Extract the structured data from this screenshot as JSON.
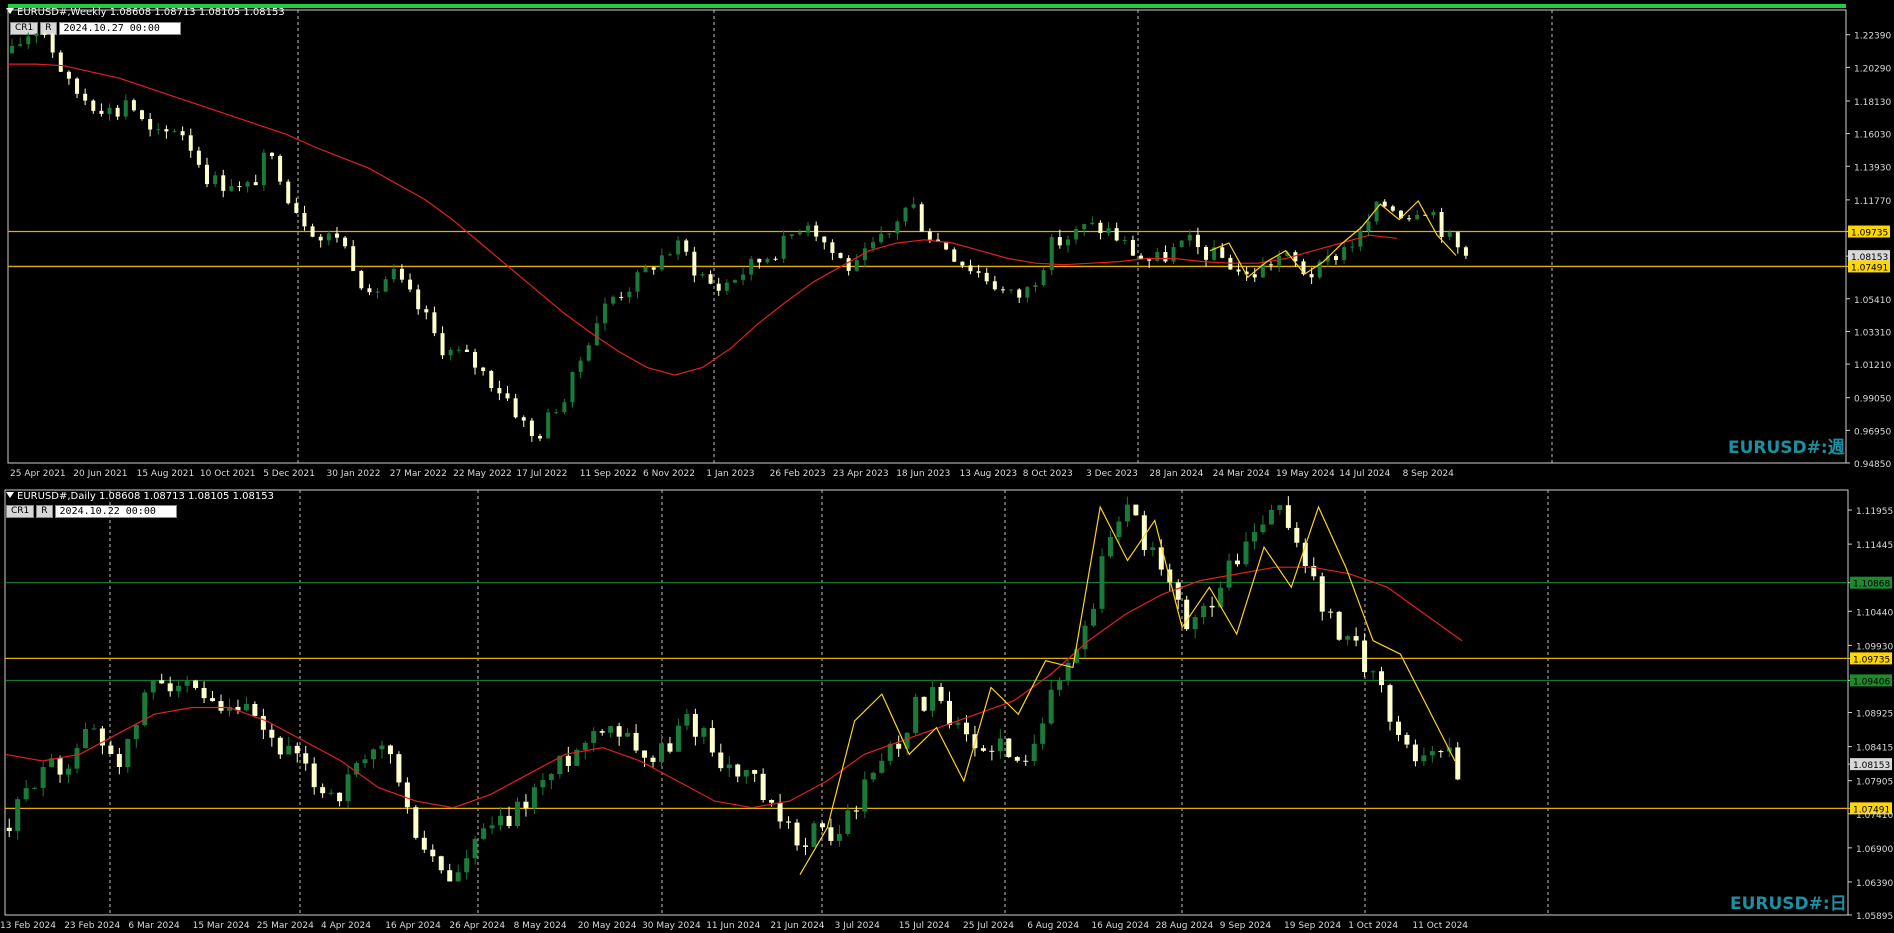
{
  "colors": {
    "bull": "#1a7a3a",
    "bear": "#ffffcc",
    "ma": "#e02020",
    "zigzag": "#ffd21e",
    "hline": "#e0b000",
    "green_line": "#1d8a2f",
    "grid": "#bfbfbf",
    "axis_text": "#d8d8d8",
    "watermark": "#1e8fa0"
  },
  "toolbar": {
    "cr1": "CR1",
    "r": "R"
  },
  "weekly": {
    "header": "EURUSD#,Weekly  1.08608 1.08713 1.08105 1.08153",
    "date_box": "2024.10.27  00:00",
    "watermark": "EURUSD#:週",
    "chart_data": {
      "type": "candlestick",
      "ylim": [
        0.9485,
        1.2398
      ],
      "yticks": [
        "1.22390",
        "1.20290",
        "1.18130",
        "1.16030",
        "1.13930",
        "1.11770",
        "1.09735",
        "1.08153",
        "1.07491",
        "1.05410",
        "1.03310",
        "1.01210",
        "0.99050",
        "0.96950",
        "0.94850"
      ],
      "xlabels": [
        "25 Apr 2021",
        "20 Jun 2021",
        "15 Aug 2021",
        "10 Oct 2021",
        "5 Dec 2021",
        "30 Jan 2022",
        "27 Mar 2022",
        "22 May 2022",
        "17 Jul 2022",
        "11 Sep 2022",
        "6 Nov 2022",
        "1 Jan 2023",
        "26 Feb 2023",
        "23 Apr 2023",
        "18 Jun 2023",
        "13 Aug 2023",
        "8 Oct 2023",
        "3 Dec 2023",
        "28 Jan 2024",
        "24 Mar 2024",
        "19 May 2024",
        "14 Jul 2024",
        "8 Sep 2024"
      ],
      "hlines": [
        {
          "value": 1.09735,
          "label": "1.09735"
        },
        {
          "value": 1.07491,
          "label": "1.07491"
        }
      ],
      "current_price": "1.08153",
      "close_path": [
        1.212,
        1.222,
        1.228,
        1.225,
        1.206,
        1.19,
        1.185,
        1.18,
        1.178,
        1.172,
        1.185,
        1.17,
        1.16,
        1.158,
        1.165,
        1.16,
        1.145,
        1.132,
        1.128,
        1.13,
        1.122,
        1.13,
        1.145,
        1.14,
        1.12,
        1.108,
        1.1,
        1.09,
        1.098,
        1.085,
        1.072,
        1.052,
        1.065,
        1.07,
        1.06,
        1.05,
        1.04,
        1.025,
        1.02,
        1.018,
        1.013,
        1.005,
        0.998,
        0.99,
        0.978,
        0.965,
        0.97,
        0.985,
        0.99,
        1.01,
        1.03,
        1.045,
        1.055,
        1.06,
        1.065,
        1.072,
        1.08,
        1.085,
        1.088,
        1.075,
        1.068,
        1.06,
        1.065,
        1.07,
        1.075,
        1.08,
        1.085,
        1.09,
        1.1,
        1.105,
        1.095,
        1.085,
        1.078,
        1.072,
        1.082,
        1.09,
        1.095,
        1.11,
        1.115,
        1.1,
        1.092,
        1.088,
        1.08,
        1.075,
        1.07,
        1.065,
        1.058,
        1.055,
        1.06,
        1.072,
        1.088,
        1.092,
        1.095,
        1.1,
        1.1,
        1.098,
        1.092,
        1.085,
        1.08,
        1.078,
        1.082,
        1.087,
        1.09,
        1.085,
        1.082,
        1.08,
        1.074,
        1.068,
        1.072,
        1.078,
        1.082,
        1.078,
        1.072,
        1.07,
        1.078,
        1.085,
        1.09,
        1.095,
        1.11,
        1.115,
        1.112,
        1.108,
        1.115,
        1.112,
        1.098,
        1.088,
        1.082
      ],
      "ma_path": [
        1.205,
        1.205,
        1.204,
        1.2,
        1.196,
        1.19,
        1.184,
        1.178,
        1.172,
        1.166,
        1.16,
        1.152,
        1.145,
        1.138,
        1.128,
        1.118,
        1.105,
        1.09,
        1.075,
        1.06,
        1.045,
        1.032,
        1.02,
        1.01,
        1.005,
        1.01,
        1.022,
        1.038,
        1.052,
        1.065,
        1.075,
        1.085,
        1.09,
        1.092,
        1.09,
        1.085,
        1.08,
        1.077,
        1.076,
        1.077,
        1.078,
        1.08,
        1.08,
        1.078,
        1.077,
        1.077,
        1.08,
        1.085,
        1.09,
        1.095,
        1.093
      ],
      "zigzag": [
        1.085,
        1.09,
        1.068,
        1.078,
        1.085,
        1.07,
        1.078,
        1.09,
        1.1,
        1.115,
        1.105,
        1.117,
        1.095,
        1.082
      ]
    }
  },
  "daily": {
    "header": "EURUSD#,Daily  1.08608 1.08713 1.08105 1.08153",
    "date_box": "2024.10.22  00:00",
    "watermark": "EURUSD#:日",
    "chart_data": {
      "type": "candlestick",
      "ylim": [
        1.05895,
        1.12255
      ],
      "yticks": [
        "1.11955",
        "1.11445",
        "1.10868",
        "1.10440",
        "1.09930",
        "1.09735",
        "1.09406",
        "1.08925",
        "1.08415",
        "1.08153",
        "1.07905",
        "1.07491",
        "1.07410",
        "1.06900",
        "1.06390",
        "1.05895"
      ],
      "xlabels": [
        "13 Feb 2024",
        "23 Feb 2024",
        "6 Mar 2024",
        "15 Mar 2024",
        "25 Mar 2024",
        "4 Apr 2024",
        "16 Apr 2024",
        "26 Apr 2024",
        "8 May 2024",
        "20 May 2024",
        "30 May 2024",
        "11 Jun 2024",
        "21 Jun 2024",
        "3 Jul 2024",
        "15 Jul 2024",
        "25 Jul 2024",
        "6 Aug 2024",
        "16 Aug 2024",
        "28 Aug 2024",
        "9 Sep 2024",
        "19 Sep 2024",
        "1 Oct 2024",
        "11 Oct 2024"
      ],
      "hlines": [
        {
          "value": 1.09735,
          "label": "1.09735"
        },
        {
          "value": 1.07491,
          "label": "1.07491"
        }
      ],
      "green_lines": [
        {
          "value": 1.10868,
          "label": "1.10868"
        },
        {
          "value": 1.09406,
          "label": "1.09406"
        }
      ],
      "current_price": "1.08153",
      "close_path": [
        1.072,
        1.077,
        1.082,
        1.08,
        1.084,
        1.087,
        1.084,
        1.082,
        1.09,
        1.095,
        1.094,
        1.092,
        1.09,
        1.088,
        1.09,
        1.087,
        1.085,
        1.083,
        1.08,
        1.078,
        1.077,
        1.08,
        1.082,
        1.085,
        1.075,
        1.07,
        1.066,
        1.064,
        1.068,
        1.072,
        1.072,
        1.075,
        1.078,
        1.08,
        1.083,
        1.085,
        1.088,
        1.087,
        1.085,
        1.082,
        1.084,
        1.088,
        1.087,
        1.083,
        1.08,
        1.08,
        1.075,
        1.072,
        1.07,
        1.072,
        1.07,
        1.074,
        1.078,
        1.083,
        1.085,
        1.09,
        1.092,
        1.088,
        1.085,
        1.083,
        1.086,
        1.08,
        1.085,
        1.09,
        1.095,
        1.1,
        1.107,
        1.118,
        1.12,
        1.115,
        1.11,
        1.105,
        1.102,
        1.106,
        1.11,
        1.114,
        1.117,
        1.119,
        1.117,
        1.11,
        1.104,
        1.1,
        1.098,
        1.095,
        1.088,
        1.084,
        1.082,
        1.085,
        1.081
      ],
      "ma_path": [
        1.083,
        1.082,
        1.083,
        1.086,
        1.089,
        1.09,
        1.09,
        1.088,
        1.085,
        1.082,
        1.078,
        1.076,
        1.075,
        1.077,
        1.08,
        1.083,
        1.084,
        1.082,
        1.079,
        1.076,
        1.075,
        1.076,
        1.079,
        1.083,
        1.085,
        1.087,
        1.089,
        1.091,
        1.095,
        1.1,
        1.104,
        1.107,
        1.109,
        1.11,
        1.111,
        1.111,
        1.11,
        1.108,
        1.104,
        1.1
      ],
      "zigzag": [
        1.065,
        1.072,
        1.088,
        1.092,
        1.083,
        1.087,
        1.079,
        1.093,
        1.089,
        1.097,
        1.096,
        1.12,
        1.112,
        1.118,
        1.102,
        1.108,
        1.101,
        1.114,
        1.108,
        1.12,
        1.111,
        1.1,
        1.098,
        1.09,
        1.082
      ]
    }
  }
}
